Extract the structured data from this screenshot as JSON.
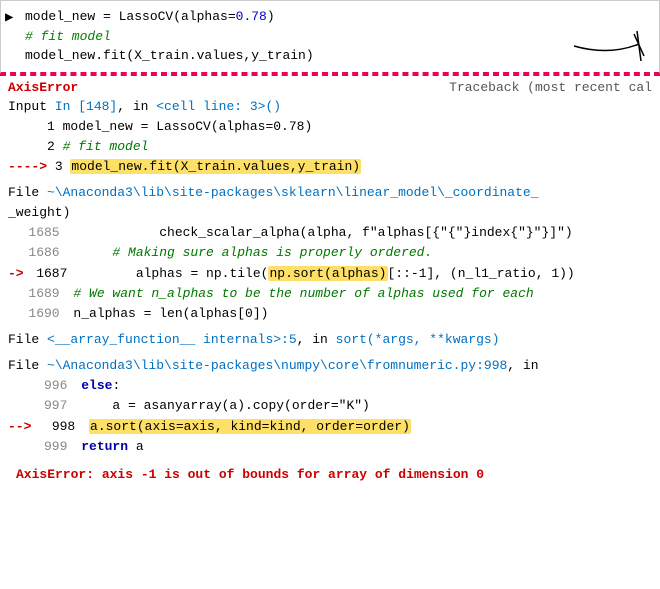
{
  "code_input": {
    "lines": [
      "model_new = LassoCV(alphas=0.78)",
      "# fit model",
      "model_new.fit(X_train.values,y_train)"
    ],
    "comment": "# fit model"
  },
  "traceback": {
    "header_error": "AxisError",
    "header_traceback": "Traceback (most recent cal",
    "input_line": "Input In [148], in <cell line: 3>()",
    "input_lines": [
      "     1 model_new = LassoCV(alphas=0.78)",
      "     2 # fit model",
      "----> 3 model_new.fit(X_train.values,y_train)"
    ],
    "file1": "File ~\\Anaconda3\\lib\\site-packages\\sklearn\\linear_model\\_coordinate_",
    "file1b": "_weight)",
    "file1_lines": [
      "  1685             check_scalar_alpha(alpha, f\"alphas[{index}]\")",
      "  1686       # Making sure alphas is properly ordered.",
      "-> 1687         alphas = np.tile(np.sort(alphas)[::-1], (n_l1_ratio, 1))",
      "  1689 # We want n_alphas to be the number of alphas used for each",
      "  1690 n_alphas = len(alphas[0])"
    ],
    "file2": "File <__array_function__ internals>:5, in sort(*args, **kwargs)",
    "file3": "File ~\\Anaconda3\\lib\\site-packages\\numpy\\core\\fromnumeric.py:998, in",
    "file3_lines": [
      "   996 else:",
      "   997     a = asanyarray(a).copy(order=\"K\")",
      "--> 998 a.sort(axis=axis, kind=kind, order=order)",
      "   999 return a"
    ],
    "footer_error": "AxisError: axis -1 is out of bounds for array of dimension 0"
  }
}
